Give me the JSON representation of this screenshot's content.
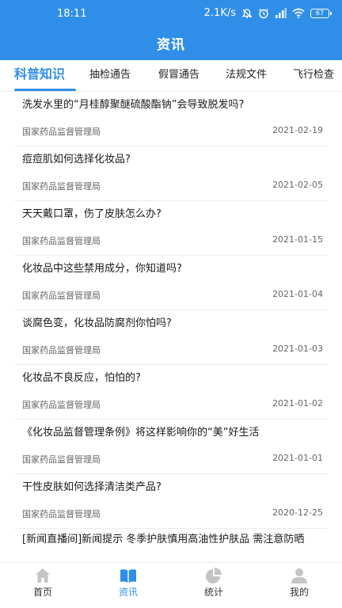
{
  "status_bar": {
    "time": "18:11",
    "net_speed": "2.1K/s",
    "battery": "67"
  },
  "header": {
    "title": "资讯"
  },
  "tabs": [
    {
      "label": "科普知识",
      "active": true
    },
    {
      "label": "抽检通告",
      "active": false
    },
    {
      "label": "假冒通告",
      "active": false
    },
    {
      "label": "法规文件",
      "active": false
    },
    {
      "label": "飞行检查",
      "active": false
    }
  ],
  "articles": [
    {
      "title": "洗发水里的“月桂醇聚醚硫酸酯钠”会导致脱发吗?",
      "source": "国家药品监督管理局",
      "date": "2021-02-19"
    },
    {
      "title": "痘痘肌如何选择化妆品?",
      "source": "国家药品监督管理局",
      "date": "2021-02-05"
    },
    {
      "title": "天天戴口罩，伤了皮肤怎么办?",
      "source": "国家药品监督管理局",
      "date": "2021-01-15"
    },
    {
      "title": "化妆品中这些禁用成分，你知道吗?",
      "source": "国家药品监督管理局",
      "date": "2021-01-04"
    },
    {
      "title": "谈腐色变，化妆品防腐剂你怕吗?",
      "source": "国家药品监督管理局",
      "date": "2021-01-03"
    },
    {
      "title": "化妆品不良反应，怕怕的?",
      "source": "国家药品监督管理局",
      "date": "2021-01-02"
    },
    {
      "title": "《化妆品监督管理条例》将这样影响你的“美”好生活",
      "source": "国家药品监督管理局",
      "date": "2021-01-01"
    },
    {
      "title": "干性皮肤如何选择清洁类产品?",
      "source": "国家药品监督管理局",
      "date": "2020-12-25"
    },
    {
      "title": "[新闻直播间]新闻提示 冬季护肤慎用高油性护肤品 需注意防晒",
      "source": "",
      "date": ""
    }
  ],
  "bottom_nav": [
    {
      "label": "首页",
      "icon": "home-icon",
      "active": false
    },
    {
      "label": "资讯",
      "icon": "book-icon",
      "active": true
    },
    {
      "label": "统计",
      "icon": "pie-chart-icon",
      "active": false
    },
    {
      "label": "我的",
      "icon": "user-icon",
      "active": false
    }
  ],
  "colors": {
    "primary": "#2f8fe8",
    "inactive_icon": "#c4c4c4"
  }
}
